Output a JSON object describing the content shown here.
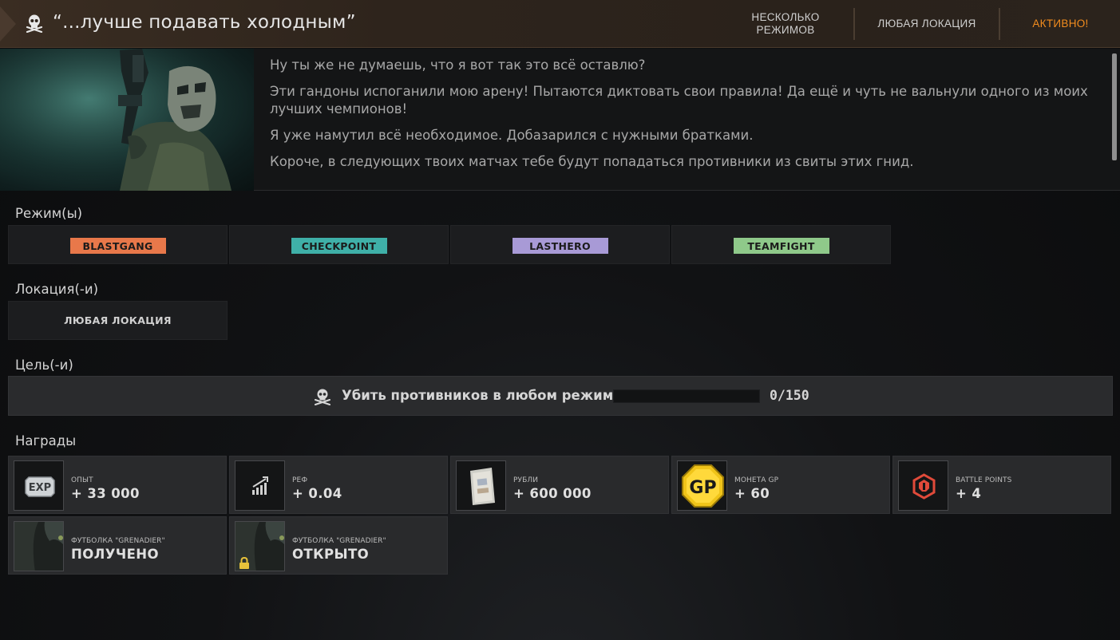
{
  "header": {
    "title": "“...лучше подавать холодным”",
    "modes_label": "НЕСКОЛЬКО\nРЕЖИМОВ",
    "location_label": "ЛЮБАЯ ЛОКАЦИЯ",
    "status_label": "АКТИВНО!",
    "status_color": "#f28c1e"
  },
  "story": {
    "paragraphs": [
      "Ну ты же не думаешь, что я вот так это всё оставлю?",
      "Эти гандоны испоганили мою арену! Пытаются диктовать свои правила! Да ещё и чуть не вальнули одного из моих лучших чемпионов!",
      "Я уже намутил всё необходимое. Добазарился с нужными братками.",
      "Короче, в следующих твоих матчах тебе будут попадаться противники из свиты этих гнид."
    ]
  },
  "sections": {
    "modes": "Режим(ы)",
    "locations": "Локация(-и)",
    "goals": "Цель(-и)",
    "rewards": "Награды"
  },
  "modes": [
    {
      "label": "BLASTGANG",
      "color": "#e8784a"
    },
    {
      "label": "CHECKPOINT",
      "color": "#3fb0a8"
    },
    {
      "label": "LASTHERO",
      "color": "#a89ad6"
    },
    {
      "label": "TEAMFIGHT",
      "color": "#8fc98a"
    }
  ],
  "locations": [
    {
      "label": "ЛЮБАЯ ЛОКАЦИЯ"
    }
  ],
  "goal": {
    "icon": "skull-icon",
    "text": "Убить противников в любом режиме",
    "progress": 0,
    "count": "0/150"
  },
  "rewards": [
    {
      "icon": "exp-icon",
      "name": "ОПЫТ",
      "value": "+ 33 000"
    },
    {
      "icon": "ref-chart-icon",
      "name": "РЕФ",
      "value": "+ 0.04"
    },
    {
      "icon": "rubles-icon",
      "name": "РУБЛИ",
      "value": "+ 600 000"
    },
    {
      "icon": "gp-coin-icon",
      "name": "МОНЕТА GP",
      "value": "+ 60"
    },
    {
      "icon": "battle-points-icon",
      "name": "BATTLE POINTS",
      "value": "+ 4"
    },
    {
      "icon": "tshirt-icon",
      "name": "ФУТБОЛКА \"GRENADIER\"",
      "value": "ПОЛУЧЕНО"
    },
    {
      "icon": "tshirt-icon",
      "name": "ФУТБОЛКА \"GRENADIER\"",
      "value": "ОТКРЫТО",
      "locked": true
    }
  ]
}
